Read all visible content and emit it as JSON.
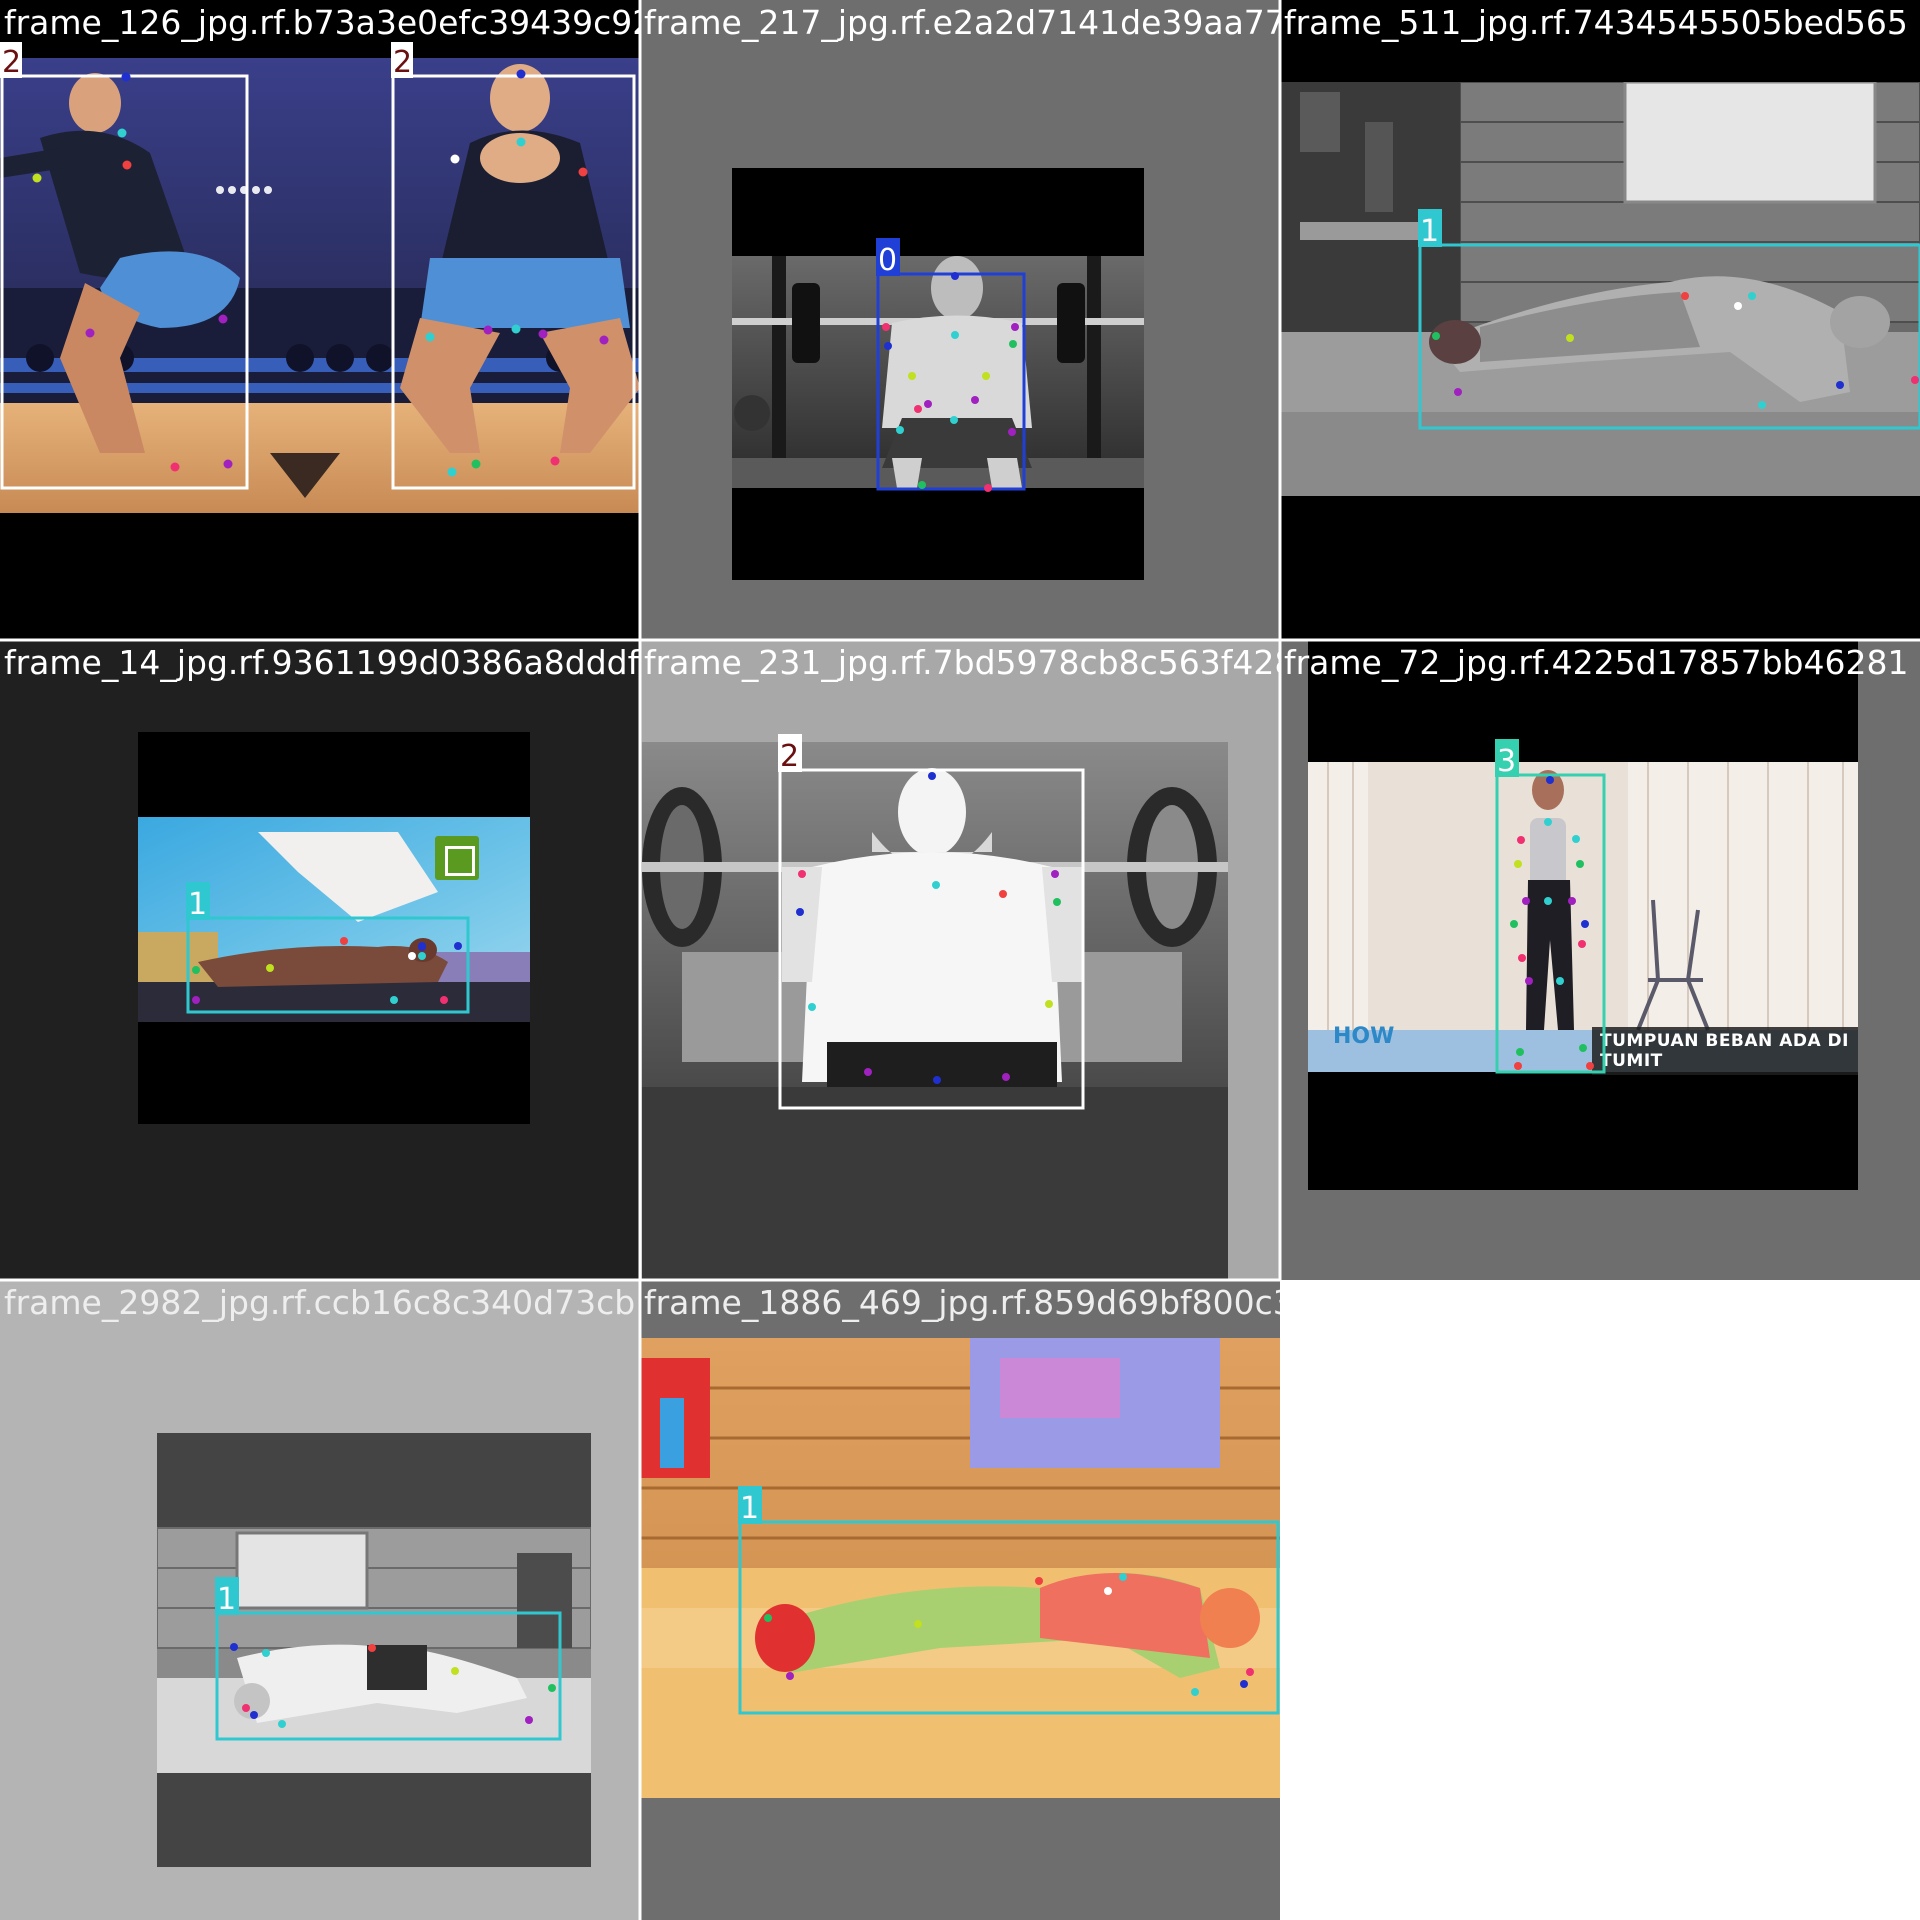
{
  "mosaic": {
    "tiles": [
      {
        "id": "t0",
        "filename": "frame_126_jpg.rf.b73a3e0efc39439c9254896",
        "boxes": [
          {
            "label": "2",
            "color": "#ffffff"
          },
          {
            "label": "2",
            "color": "#ffffff"
          }
        ]
      },
      {
        "id": "t1",
        "filename": "frame_217_jpg.rf.e2a2d7141de39aa77c9a4f6",
        "boxes": [
          {
            "label": "0",
            "color": "#1f3fd6"
          }
        ]
      },
      {
        "id": "t2",
        "filename": "frame_511_jpg.rf.7434545505bed565",
        "boxes": [
          {
            "label": "1",
            "color": "#30c8d0"
          }
        ]
      },
      {
        "id": "t3",
        "filename": "frame_14_jpg.rf.9361199d0386a8dddf6d6622",
        "boxes": [
          {
            "label": "1",
            "color": "#30c8d0"
          }
        ]
      },
      {
        "id": "t4",
        "filename": "frame_231_jpg.rf.7bd5978cb8c563f428159372",
        "boxes": [
          {
            "label": "2",
            "color": "#ffffff"
          }
        ]
      },
      {
        "id": "t5",
        "filename": "frame_72_jpg.rf.4225d17857bb46281",
        "caption": "TUMPUAN BEBAN ADA DI TUMIT",
        "logo_text": "HOW",
        "boxes": [
          {
            "label": "3",
            "color": "#35d0b0"
          }
        ]
      },
      {
        "id": "t6",
        "filename": "frame_2982_jpg.rf.ccb16c8c340d73cb",
        "boxes": [
          {
            "label": "1",
            "color": "#30c8d0"
          }
        ]
      },
      {
        "id": "t7",
        "filename": "frame_1886_469_jpg.rf.859d69bf800c3957b91bd8c",
        "boxes": [
          {
            "label": "1",
            "color": "#30c8d0"
          }
        ]
      }
    ]
  }
}
